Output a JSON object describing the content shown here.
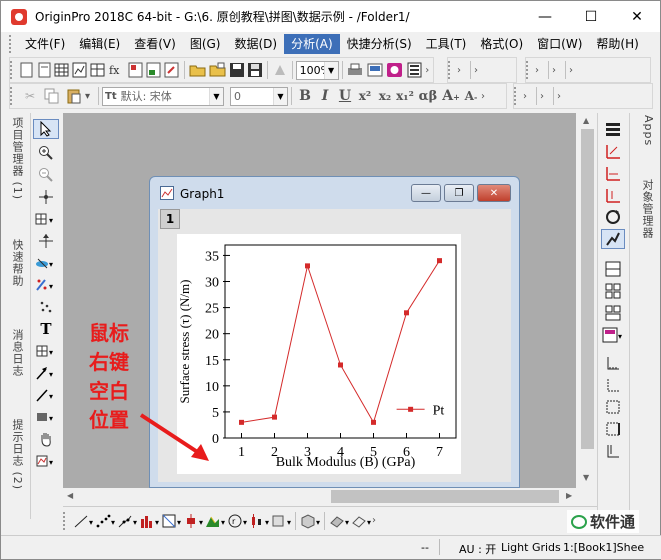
{
  "app": {
    "title": "OriginPro 2018C 64-bit - G:\\6. 原创教程\\拼图\\数据示例 - /Folder1/"
  },
  "menu": [
    {
      "label": "文件(F)",
      "active": false
    },
    {
      "label": "编辑(E)",
      "active": false
    },
    {
      "label": "查看(V)",
      "active": false
    },
    {
      "label": "图(G)",
      "active": false
    },
    {
      "label": "数据(D)",
      "active": false
    },
    {
      "label": "分析(A)",
      "active": true
    },
    {
      "label": "快捷分析(S)",
      "active": false
    },
    {
      "label": "工具(T)",
      "active": false
    },
    {
      "label": "格式(O)",
      "active": false
    },
    {
      "label": "窗口(W)",
      "active": false
    },
    {
      "label": "帮助(H)",
      "active": false
    }
  ],
  "toolbar": {
    "zoom": "100%",
    "font_name": "默认: 宋体",
    "font_size": "0"
  },
  "left_dock": {
    "tabs": [
      "项目管理器 (1)",
      "快速帮助",
      "消息日志",
      "提示日志 (2)"
    ]
  },
  "right_dock": {
    "tabs": [
      "Apps",
      "对象管理器"
    ]
  },
  "graph_window": {
    "title": "Graph1",
    "layer": "1",
    "legend": "Pt"
  },
  "chart_data": {
    "type": "line",
    "x": [
      1,
      2,
      3,
      4,
      5,
      6,
      7
    ],
    "series": [
      {
        "name": "Pt",
        "values": [
          3,
          4,
          33,
          14,
          3,
          24,
          34
        ],
        "color": "#d42a2a",
        "marker": "square"
      }
    ],
    "xlabel": "Bulk Modulus (B) (GPa)",
    "ylabel": "Surface stress (τ) (N/m)",
    "xlim": [
      0.5,
      7.5
    ],
    "ylim": [
      0,
      37
    ],
    "xticks": [
      "1",
      "2",
      "3",
      "4",
      "5",
      "6",
      "7"
    ],
    "yticks": [
      "0",
      "5",
      "10",
      "15",
      "20",
      "25",
      "30",
      "35"
    ],
    "grid": false,
    "legend_position": "inside-right"
  },
  "annotation": {
    "lines": [
      "鼠标",
      "右键",
      "空白",
      "位置"
    ],
    "color": "#e81c1c"
  },
  "status": {
    "au": "AU : 开",
    "theme": "Light Grids",
    "sheet": "1:[Book1]Shee"
  },
  "watermark": "软件通"
}
